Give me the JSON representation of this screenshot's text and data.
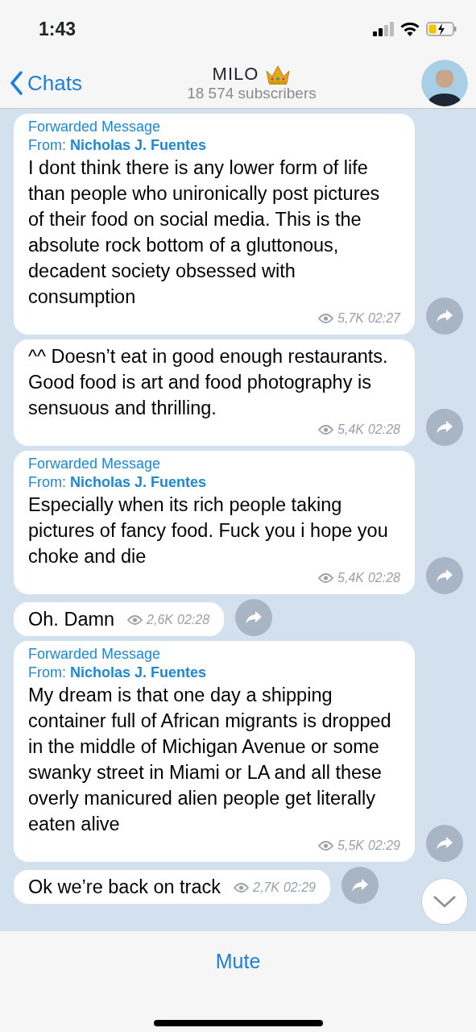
{
  "status_bar": {
    "time": "1:43"
  },
  "header": {
    "back": "Chats",
    "title": "MILO",
    "subtitle": "18 574 subscribers"
  },
  "messages": [
    {
      "forwarded": {
        "label": "Forwarded Message",
        "from_label": "From:",
        "from": "Nicholas J. Fuentes"
      },
      "text": "I dont think there is any lower form of life than people who unironically post pictures of their food on social media. This is the absolute rock bottom of a gluttonous, decadent society obsessed with consumption",
      "views": "5,7K",
      "time": "02:27"
    },
    {
      "text": "^^ Doesn’t eat in good enough restaurants. Good food is art and food photography is sensuous and thrilling.",
      "views": "5,4K",
      "time": "02:28"
    },
    {
      "forwarded": {
        "label": "Forwarded Message",
        "from_label": "From:",
        "from": "Nicholas J. Fuentes"
      },
      "text": "Especially when its rich people taking pictures of fancy food. Fuck you i hope you choke and die",
      "views": "5,4K",
      "time": "02:28"
    },
    {
      "text": "Oh. Damn",
      "views": "2,6K",
      "time": "02:28"
    },
    {
      "forwarded": {
        "label": "Forwarded Message",
        "from_label": "From:",
        "from": "Nicholas J. Fuentes"
      },
      "text": "My dream is that one day a shipping container full of African migrants is dropped in the middle of Michigan Avenue or some swanky street in Miami or LA and all these overly manicured alien people get literally eaten alive",
      "views": "5,5K",
      "time": "02:29"
    },
    {
      "text": "Ok we’re back on track",
      "views": "2,7K",
      "time": "02:29"
    }
  ],
  "footer": {
    "button": "Mute"
  }
}
